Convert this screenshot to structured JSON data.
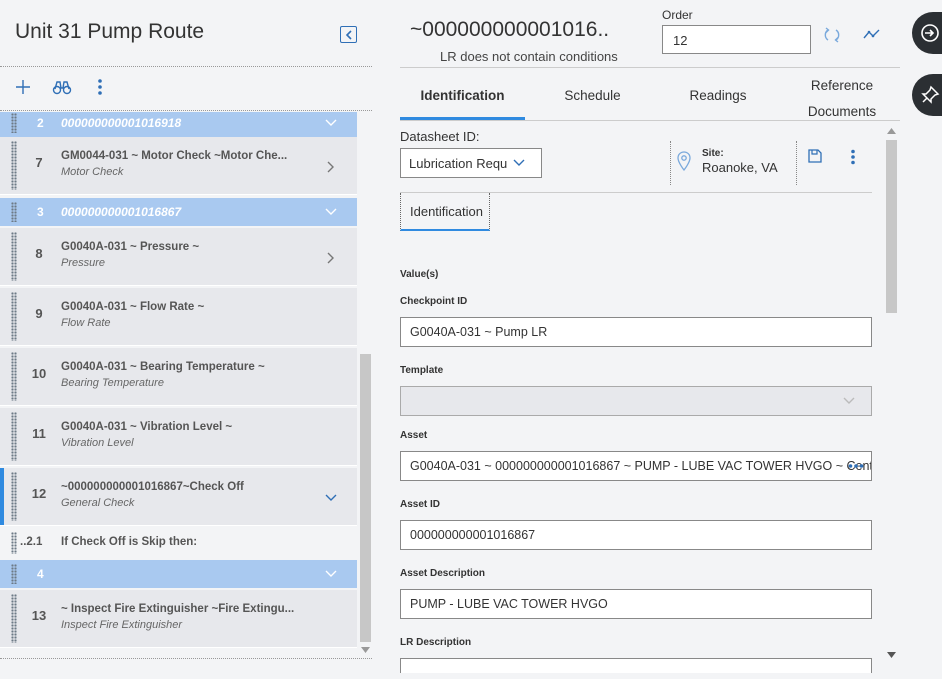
{
  "route": {
    "title": "Unit 31 Pump Route",
    "rows": [
      {
        "kind": "group",
        "num": "2",
        "name": "000000000001016918"
      },
      {
        "kind": "item",
        "num": "7",
        "title": "GM0044-031 ~ Motor Check ~Motor Che...",
        "subtitle": "Motor Check",
        "chevron": "right"
      },
      {
        "kind": "group",
        "num": "3",
        "name": "000000000001016867"
      },
      {
        "kind": "item",
        "num": "8",
        "title": "G0040A-031 ~ Pressure ~",
        "subtitle": "Pressure",
        "chevron": "right"
      },
      {
        "kind": "item",
        "num": "9",
        "title": "G0040A-031 ~ Flow Rate ~",
        "subtitle": "Flow Rate",
        "chevron": ""
      },
      {
        "kind": "item",
        "num": "10",
        "title": "G0040A-031 ~ Bearing Temperature ~",
        "subtitle": "Bearing Temperature",
        "chevron": ""
      },
      {
        "kind": "item",
        "num": "11",
        "title": "G0040A-031 ~ Vibration Level ~",
        "subtitle": "Vibration Level",
        "chevron": ""
      },
      {
        "kind": "item",
        "num": "12",
        "title": "~000000000001016867~Check Off",
        "subtitle": "General Check",
        "chevron": "down",
        "active": true
      },
      {
        "kind": "sub",
        "num": "..2.1",
        "title": "If Check Off is Skip then:"
      },
      {
        "kind": "group",
        "num": "4",
        "name": ""
      },
      {
        "kind": "item",
        "num": "13",
        "title": "~ Inspect Fire Extinguisher ~Fire Extingu...",
        "subtitle": "Inspect Fire Extinguisher",
        "chevron": ""
      }
    ]
  },
  "record": {
    "title": "~000000000001016..",
    "subtitle": "LR does not contain conditions",
    "order_label": "Order",
    "order_value": "12"
  },
  "tabs": [
    "Identification",
    "Schedule",
    "Readings",
    "Reference Documents"
  ],
  "datasheet": {
    "label": "Datasheet ID:",
    "value": "Lubrication Requ",
    "site_label": "Site:",
    "site_value": "Roanoke, VA",
    "section_tab": "Identification"
  },
  "form": {
    "values_label": "Value(s)",
    "checkpoint_id_label": "Checkpoint ID",
    "checkpoint_id": "G0040A-031 ~ Pump LR",
    "template_label": "Template",
    "template": "",
    "asset_label": "Asset",
    "asset": "G0040A-031 ~ 000000000001016867 ~ PUMP - LUBE VAC TOWER HVGO ~ Cent",
    "asset_id_label": "Asset ID",
    "asset_id": "000000000001016867",
    "asset_desc_label": "Asset Description",
    "asset_desc": "PUMP - LUBE VAC TOWER HVGO",
    "lr_desc_label": "LR Description"
  },
  "colors": {
    "accent": "#2f8ae0",
    "group_row": "#a9c9f0",
    "icon_blue": "#2f6fb6",
    "side_button": "#2b2f33"
  }
}
